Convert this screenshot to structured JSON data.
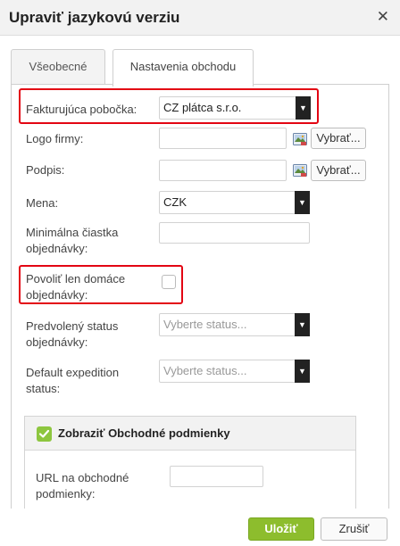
{
  "dialog": {
    "title": "Upraviť jazykovú verziu",
    "close_glyph": "✕"
  },
  "tabs": [
    {
      "label": "Všeobecné",
      "active": false
    },
    {
      "label": "Nastavenia obchodu",
      "active": true
    }
  ],
  "form": {
    "billing_branch": {
      "label": "Fakturujúca pobočka:",
      "value": "CZ plátca s.r.o."
    },
    "logo": {
      "label": "Logo firmy:",
      "value": "",
      "button": "Vybrať..."
    },
    "signature": {
      "label": "Podpis:",
      "value": "",
      "button": "Vybrať..."
    },
    "currency": {
      "label": "Mena:",
      "value": "CZK"
    },
    "min_order_amount": {
      "label_line1": "Minimálna čiastka",
      "label_line2": "objednávky:",
      "value": ""
    },
    "domestic_only": {
      "label_line1": "Povoliť len domáce",
      "label_line2": "objednávky:",
      "checked": false
    },
    "default_order_status": {
      "label_line1": "Predvolený status",
      "label_line2": "objednávky:",
      "placeholder": "Vyberte status..."
    },
    "default_expedition_status": {
      "label_line1": "Default expedition",
      "label_line2": "status:",
      "placeholder": "Vyberte status..."
    }
  },
  "terms_section": {
    "toggle_label": "Zobraziť Obchodné podmienky",
    "checked": true,
    "url_label_line1": "URL na obchodné",
    "url_label_line2": "podmienky:",
    "url_value": ""
  },
  "footer": {
    "save_label": "Uložiť",
    "cancel_label": "Zrušiť"
  },
  "colors": {
    "highlight": "#e30613",
    "save_button": "#8dbd2d",
    "checkbox_green": "#8dc63f"
  }
}
